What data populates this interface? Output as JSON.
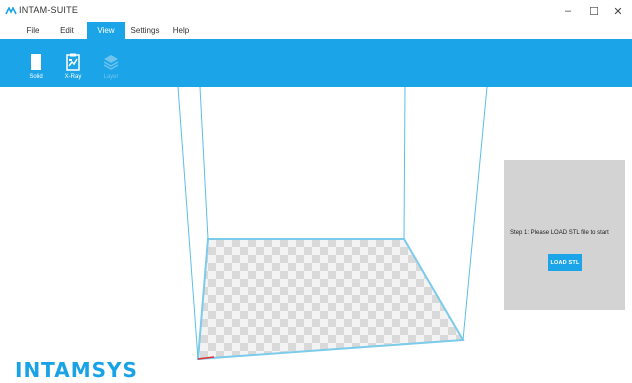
{
  "window": {
    "title": "INTAM-SUITE",
    "minimize": "–",
    "maximize": "☐",
    "close": "✕"
  },
  "menu": {
    "items": [
      "File",
      "Edit",
      "View",
      "Settings",
      "Help"
    ],
    "active": "View"
  },
  "toolbar": {
    "tools": [
      {
        "label": "Solid",
        "icon": "solid-view-icon",
        "enabled": true
      },
      {
        "label": "X-Ray",
        "icon": "xray-view-icon",
        "enabled": true
      },
      {
        "label": "Layer",
        "icon": "layer-view-icon",
        "enabled": false
      }
    ]
  },
  "panel": {
    "step_text": "Step 1: Please LOAD STL file to start",
    "button_label": "LOAD STL"
  },
  "brand": {
    "name": "INTAMSYS"
  },
  "colors": {
    "accent": "#1ba4e8",
    "panel": "#d3d3d3",
    "build_volume_edge": "#5bc0e8"
  }
}
